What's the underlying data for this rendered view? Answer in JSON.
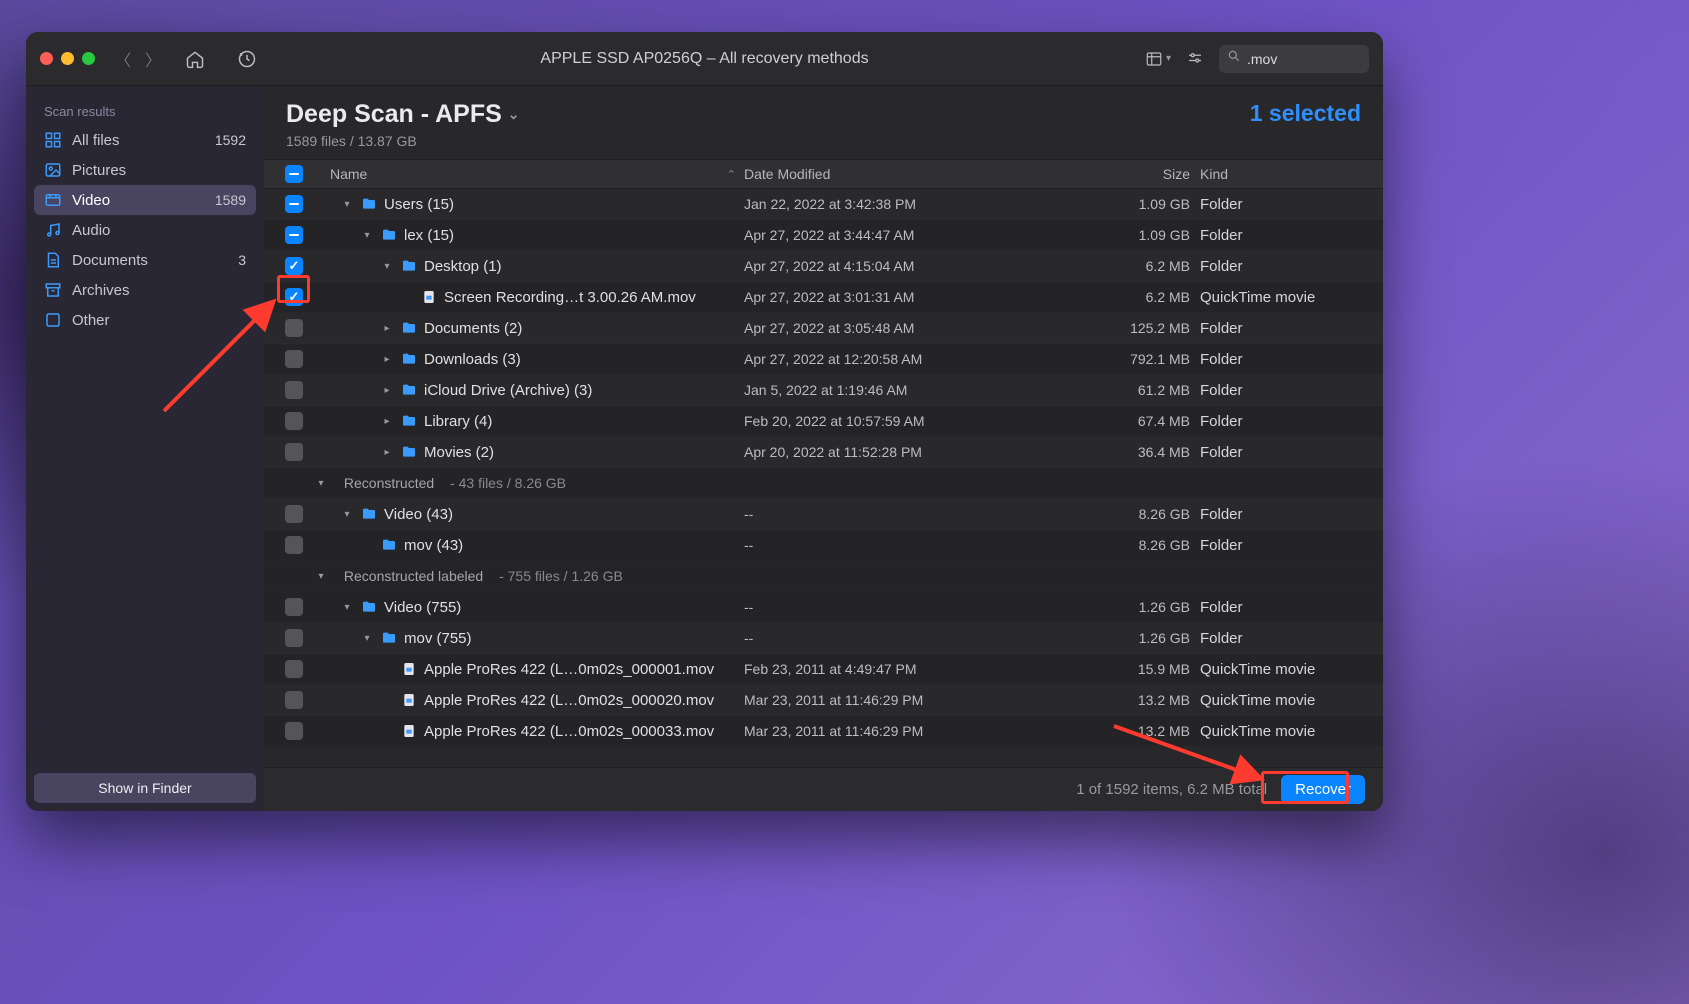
{
  "window": {
    "title": "APPLE SSD AP0256Q – All recovery methods"
  },
  "search": {
    "value": ".mov"
  },
  "sidebar": {
    "header": "Scan results",
    "show_in_finder": "Show in Finder",
    "items": [
      {
        "label": "All files",
        "count": "1592"
      },
      {
        "label": "Pictures",
        "count": ""
      },
      {
        "label": "Video",
        "count": "1589"
      },
      {
        "label": "Audio",
        "count": ""
      },
      {
        "label": "Documents",
        "count": "3"
      },
      {
        "label": "Archives",
        "count": ""
      },
      {
        "label": "Other",
        "count": ""
      }
    ]
  },
  "header": {
    "title": "Deep Scan - APFS",
    "subtitle": "1589 files / 13.87 GB",
    "selected": "1 selected"
  },
  "columns": {
    "name": "Name",
    "date": "Date Modified",
    "size": "Size",
    "kind": "Kind"
  },
  "rows": [
    {
      "indent": 1,
      "disc": "▾",
      "cb": "dash",
      "icon": "folder",
      "name": "Users (15)",
      "date": "Jan 22, 2022 at 3:42:38 PM",
      "size": "1.09 GB",
      "kind": "Folder"
    },
    {
      "indent": 2,
      "disc": "▾",
      "cb": "dash",
      "icon": "folder",
      "name": "lex (15)",
      "date": "Apr 27, 2022 at 3:44:47 AM",
      "size": "1.09 GB",
      "kind": "Folder"
    },
    {
      "indent": 3,
      "disc": "▾",
      "cb": "tick",
      "icon": "folder",
      "name": "Desktop (1)",
      "date": "Apr 27, 2022 at 4:15:04 AM",
      "size": "6.2 MB",
      "kind": "Folder"
    },
    {
      "indent": 4,
      "disc": "",
      "cb": "tick",
      "icon": "file",
      "name": "Screen Recording…t 3.00.26 AM.mov",
      "date": "Apr 27, 2022 at 3:01:31 AM",
      "size": "6.2 MB",
      "kind": "QuickTime movie"
    },
    {
      "indent": 3,
      "disc": "▸",
      "cb": "empty",
      "icon": "folder",
      "name": "Documents (2)",
      "date": "Apr 27, 2022 at 3:05:48 AM",
      "size": "125.2 MB",
      "kind": "Folder"
    },
    {
      "indent": 3,
      "disc": "▸",
      "cb": "empty",
      "icon": "folder",
      "name": "Downloads (3)",
      "date": "Apr 27, 2022 at 12:20:58 AM",
      "size": "792.1 MB",
      "kind": "Folder"
    },
    {
      "indent": 3,
      "disc": "▸",
      "cb": "empty",
      "icon": "folder",
      "name": "iCloud Drive (Archive) (3)",
      "date": "Jan 5, 2022 at 1:19:46 AM",
      "size": "61.2 MB",
      "kind": "Folder"
    },
    {
      "indent": 3,
      "disc": "▸",
      "cb": "empty",
      "icon": "folder",
      "name": "Library (4)",
      "date": "Feb 20, 2022 at 10:57:59 AM",
      "size": "67.4 MB",
      "kind": "Folder"
    },
    {
      "indent": 3,
      "disc": "▸",
      "cb": "empty",
      "icon": "folder",
      "name": "Movies (2)",
      "date": "Apr 20, 2022 at 11:52:28 PM",
      "size": "36.4 MB",
      "kind": "Folder"
    },
    {
      "section": "Reconstructed",
      "meta": "43 files / 8.26 GB"
    },
    {
      "indent": 1,
      "disc": "▾",
      "cb": "empty",
      "icon": "folder",
      "name": "Video (43)",
      "date": "--",
      "size": "8.26 GB",
      "kind": "Folder"
    },
    {
      "indent": 2,
      "disc": "",
      "cb": "empty",
      "icon": "folder",
      "name": "mov (43)",
      "date": "--",
      "size": "8.26 GB",
      "kind": "Folder"
    },
    {
      "section": "Reconstructed labeled",
      "meta": "755 files / 1.26 GB"
    },
    {
      "indent": 1,
      "disc": "▾",
      "cb": "empty",
      "icon": "folder",
      "name": "Video (755)",
      "date": "--",
      "size": "1.26 GB",
      "kind": "Folder"
    },
    {
      "indent": 2,
      "disc": "▾",
      "cb": "empty",
      "icon": "folder",
      "name": "mov (755)",
      "date": "--",
      "size": "1.26 GB",
      "kind": "Folder"
    },
    {
      "indent": 3,
      "disc": "",
      "cb": "empty",
      "icon": "file",
      "name": "Apple ProRes 422 (L…0m02s_000001.mov",
      "date": "Feb 23, 2011 at 4:49:47 PM",
      "size": "15.9 MB",
      "kind": "QuickTime movie"
    },
    {
      "indent": 3,
      "disc": "",
      "cb": "empty",
      "icon": "file",
      "name": "Apple ProRes 422 (L…0m02s_000020.mov",
      "date": "Mar 23, 2011 at 11:46:29 PM",
      "size": "13.2 MB",
      "kind": "QuickTime movie"
    },
    {
      "indent": 3,
      "disc": "",
      "cb": "empty",
      "icon": "file",
      "name": "Apple ProRes 422 (L…0m02s_000033.mov",
      "date": "Mar 23, 2011 at 11:46:29 PM",
      "size": "13.2 MB",
      "kind": "QuickTime movie"
    }
  ],
  "footer": {
    "status": "1 of 1592 items, 6.2 MB total",
    "recover": "Recover"
  }
}
